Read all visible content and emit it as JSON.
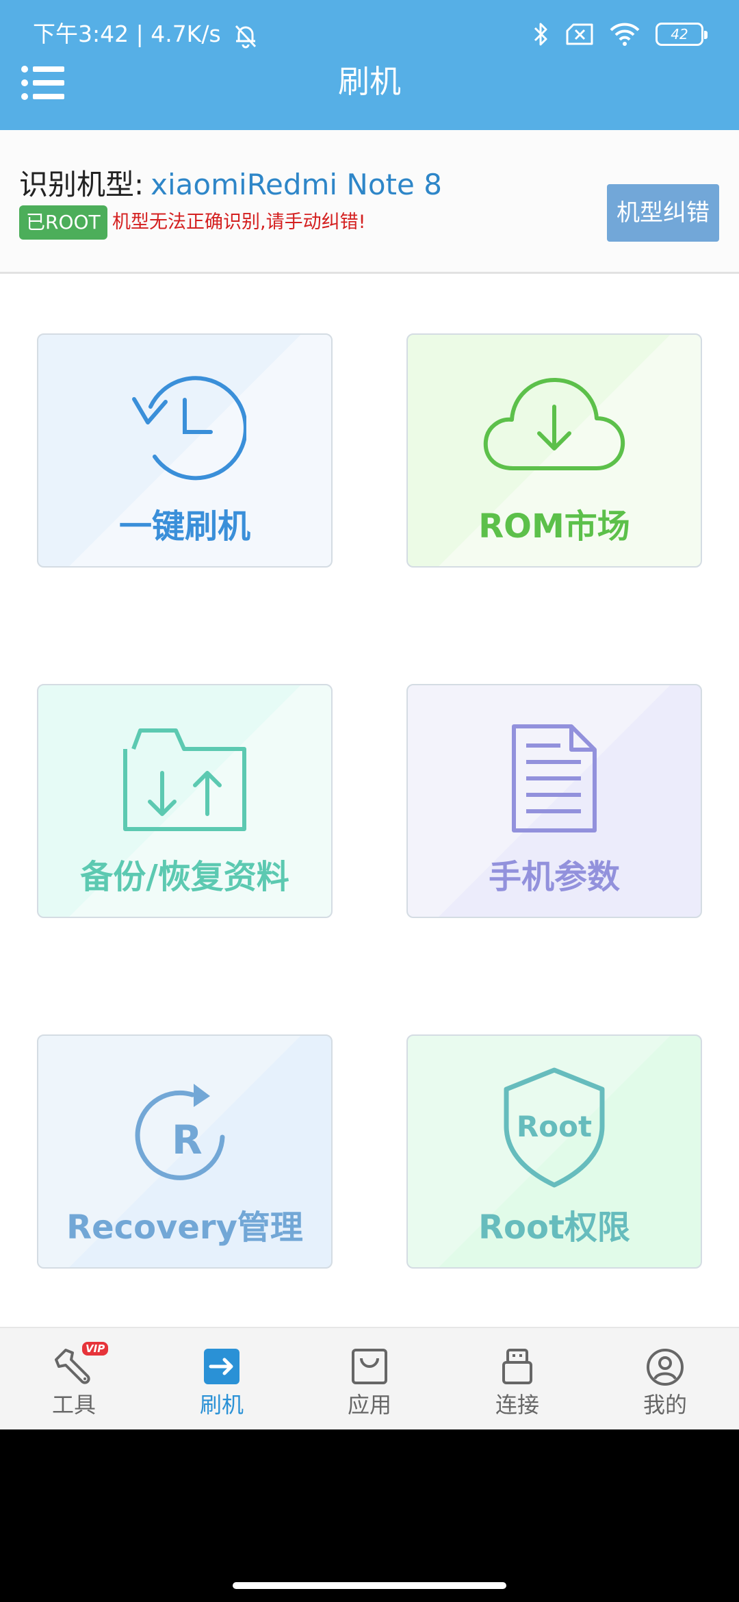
{
  "status_bar": {
    "left_text": "下午3:42 | 4.7K/s",
    "battery": "42"
  },
  "header": {
    "title": "刷机"
  },
  "device": {
    "label": "识别机型:",
    "model": "xiaomiRedmi Note 8",
    "root_badge": "已ROOT",
    "warning": "机型无法正确识别,请手动纠错!",
    "fix_button": "机型纠错"
  },
  "tiles": [
    {
      "label": "一键刷机",
      "icon": "history-clock-icon",
      "color": "#3a8fd9"
    },
    {
      "label": "ROM市场",
      "icon": "cloud-download-icon",
      "color": "#5cc04a"
    },
    {
      "label": "备份/恢复资料",
      "icon": "folder-transfer-icon",
      "color": "#5cc9b1"
    },
    {
      "label": "手机参数",
      "icon": "document-icon",
      "color": "#9291dc"
    },
    {
      "label": "Recovery管理",
      "icon": "recovery-r-icon",
      "color": "#72a7d6"
    },
    {
      "label": "Root权限",
      "icon": "root-shield-icon",
      "color": "#66bcbd"
    }
  ],
  "bottom_nav": {
    "items": [
      {
        "label": "工具",
        "icon": "wrench-icon",
        "badge": "VIP"
      },
      {
        "label": "刷机",
        "icon": "flash-arrow-icon",
        "active": true
      },
      {
        "label": "应用",
        "icon": "shopping-bag-icon"
      },
      {
        "label": "连接",
        "icon": "usb-icon"
      },
      {
        "label": "我的",
        "icon": "user-circle-icon"
      }
    ]
  },
  "colors": {
    "header_bg": "#56afe6",
    "accent": "#2a91d6",
    "warning": "#d42020",
    "root_badge": "#4cae5a",
    "fix_button": "#72a7d8"
  }
}
